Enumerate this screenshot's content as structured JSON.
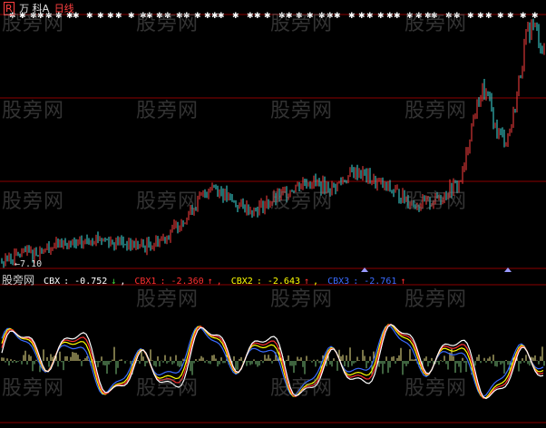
{
  "header": {
    "flag": "R",
    "stock_name": "万 科A",
    "period": "日线"
  },
  "price_low_label": "7.10",
  "indicator": {
    "title": "股旁网",
    "items": [
      {
        "key": "CBX",
        "value": "-0.752",
        "arrow": "↓",
        "color": "#ffffff"
      },
      {
        "key": "CBX1",
        "value": "-2.360",
        "arrow": "↑",
        "color": "#ff3030"
      },
      {
        "key": "CBX2",
        "value": "-2.643",
        "arrow": "↑",
        "color": "#ffff00"
      },
      {
        "key": "CBX3",
        "value": "-2.761",
        "arrow": "↑",
        "color": "#3a6bff"
      }
    ]
  },
  "watermark": "股旁网",
  "colors": {
    "background": "#000000",
    "up_candle": "#ff4040",
    "down_candle": "#40e0e0",
    "grid": "#8b0000",
    "signal_bar": "#f0e68c",
    "cbx": "#ffffff",
    "cbx1": "#ff3030",
    "cbx2": "#ffff00",
    "cbx3": "#3a6bff"
  },
  "chart_data": [
    {
      "type": "candlestick",
      "title": "",
      "series": [
        {
          "name": "",
          "close": [
            7.1,
            7.2,
            7.3,
            7.5,
            7.6,
            7.5,
            7.7,
            7.9,
            8.0,
            8.1,
            8.2,
            8.1,
            8.0,
            8.2,
            8.4,
            8.6,
            8.5,
            8.4,
            8.3,
            8.3,
            8.2,
            8.1,
            8.1,
            8.0,
            8.1,
            8.3,
            8.5,
            8.8,
            9.2,
            9.6,
            10.0,
            10.5,
            11.0,
            11.5,
            12.0,
            11.8,
            11.4,
            11.0,
            10.8,
            10.6,
            10.5,
            10.4,
            10.6,
            10.8,
            11.0,
            11.2,
            11.5,
            11.8,
            12.0,
            12.2,
            12.3,
            12.1,
            11.9,
            11.8,
            11.9,
            12.2,
            12.5,
            12.8,
            12.9,
            12.6,
            12.3,
            12.1,
            11.9,
            11.7,
            11.5,
            11.2,
            11.0,
            10.8,
            10.7,
            10.8,
            11.0,
            11.2,
            11.5,
            11.8,
            12.0,
            13.0,
            15.5,
            17.0,
            18.2,
            17.5,
            15.8,
            15.2,
            15.0,
            16.5,
            19.0,
            21.5,
            22.5,
            21.8,
            20.5
          ],
          "low_label": "7.10"
        }
      ]
    },
    {
      "type": "line",
      "title": "",
      "series": [
        {
          "name": "CBX",
          "current": -0.752
        },
        {
          "name": "CBX1",
          "current": -2.36
        },
        {
          "name": "CBX2",
          "current": -2.643
        },
        {
          "name": "CBX3",
          "current": -2.761
        }
      ]
    }
  ]
}
